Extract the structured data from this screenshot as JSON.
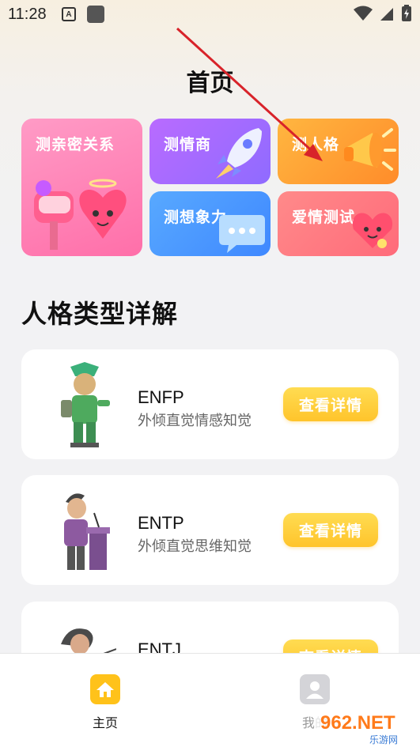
{
  "status_bar": {
    "time": "11:28",
    "notification_letter": "A"
  },
  "page": {
    "title": "首页"
  },
  "tiles": {
    "relation": "测亲密关系",
    "eq": "测情商",
    "personality": "测人格",
    "imagination": "测想象力",
    "love": "爱情测试"
  },
  "section": {
    "title": "人格类型详解"
  },
  "cards": [
    {
      "code": "ENFP",
      "desc": "外倾直觉情感知觉",
      "button": "查看详情"
    },
    {
      "code": "ENTP",
      "desc": "外倾直觉思维知觉",
      "button": "查看详情"
    },
    {
      "code": "ENTJ",
      "desc": "",
      "button": "查看详情"
    }
  ],
  "bottom_nav": {
    "home": "主页",
    "me": "我的"
  },
  "watermark": {
    "text": "962.NET",
    "sub": "乐游网"
  },
  "colors": {
    "accent": "#ffc42b",
    "arrow": "#d8232a"
  }
}
